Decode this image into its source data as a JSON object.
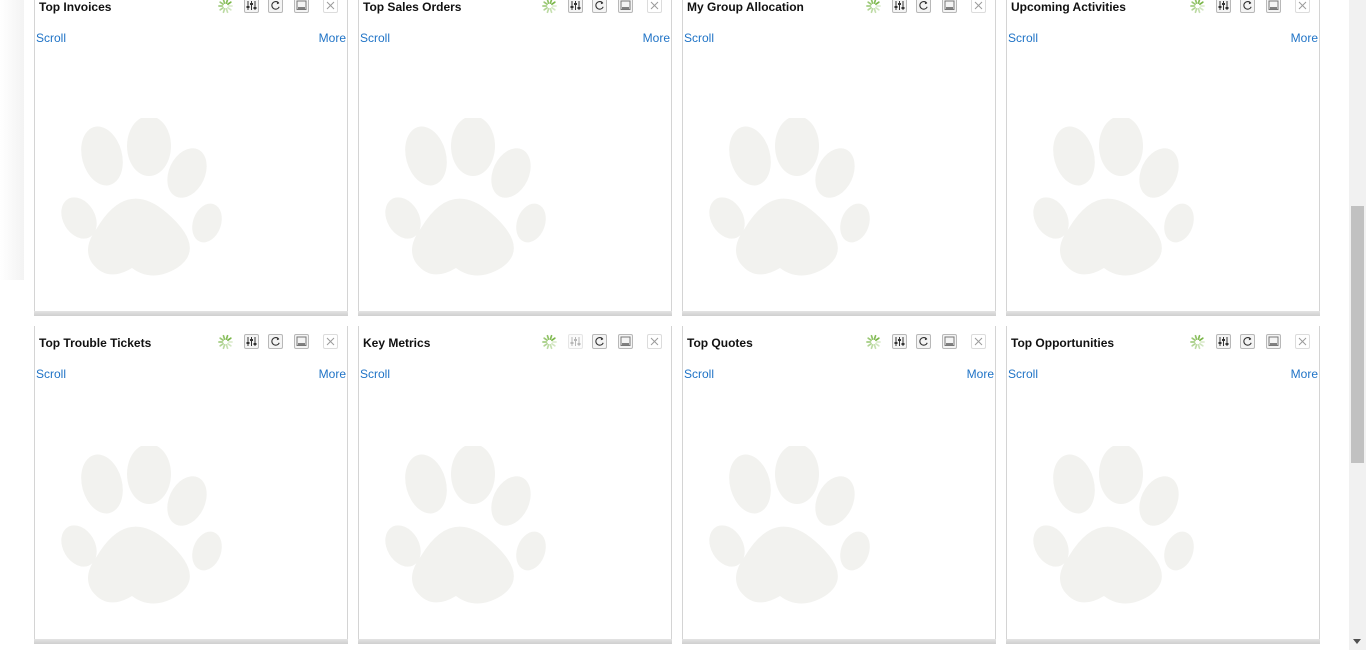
{
  "links": {
    "scroll": "Scroll",
    "more": "More"
  },
  "colors": {
    "link": "#1f73c6",
    "spinner": "#7ab648"
  },
  "widgets": [
    {
      "title": "Top Invoices",
      "show_more": true,
      "filter_disabled": false
    },
    {
      "title": "Top Sales Orders",
      "show_more": true,
      "filter_disabled": false
    },
    {
      "title": "My Group Allocation",
      "show_more": false,
      "filter_disabled": false
    },
    {
      "title": "Upcoming Activities",
      "show_more": true,
      "filter_disabled": false
    },
    {
      "title": "Top Trouble Tickets",
      "show_more": true,
      "filter_disabled": false
    },
    {
      "title": "Key Metrics",
      "show_more": false,
      "filter_disabled": true
    },
    {
      "title": "Top Quotes",
      "show_more": true,
      "filter_disabled": false
    },
    {
      "title": "Top Opportunities",
      "show_more": true,
      "filter_disabled": false
    }
  ],
  "icons": [
    "loading-spinner-icon",
    "filter-settings-icon",
    "refresh-icon",
    "minimize-icon",
    "close-icon"
  ]
}
